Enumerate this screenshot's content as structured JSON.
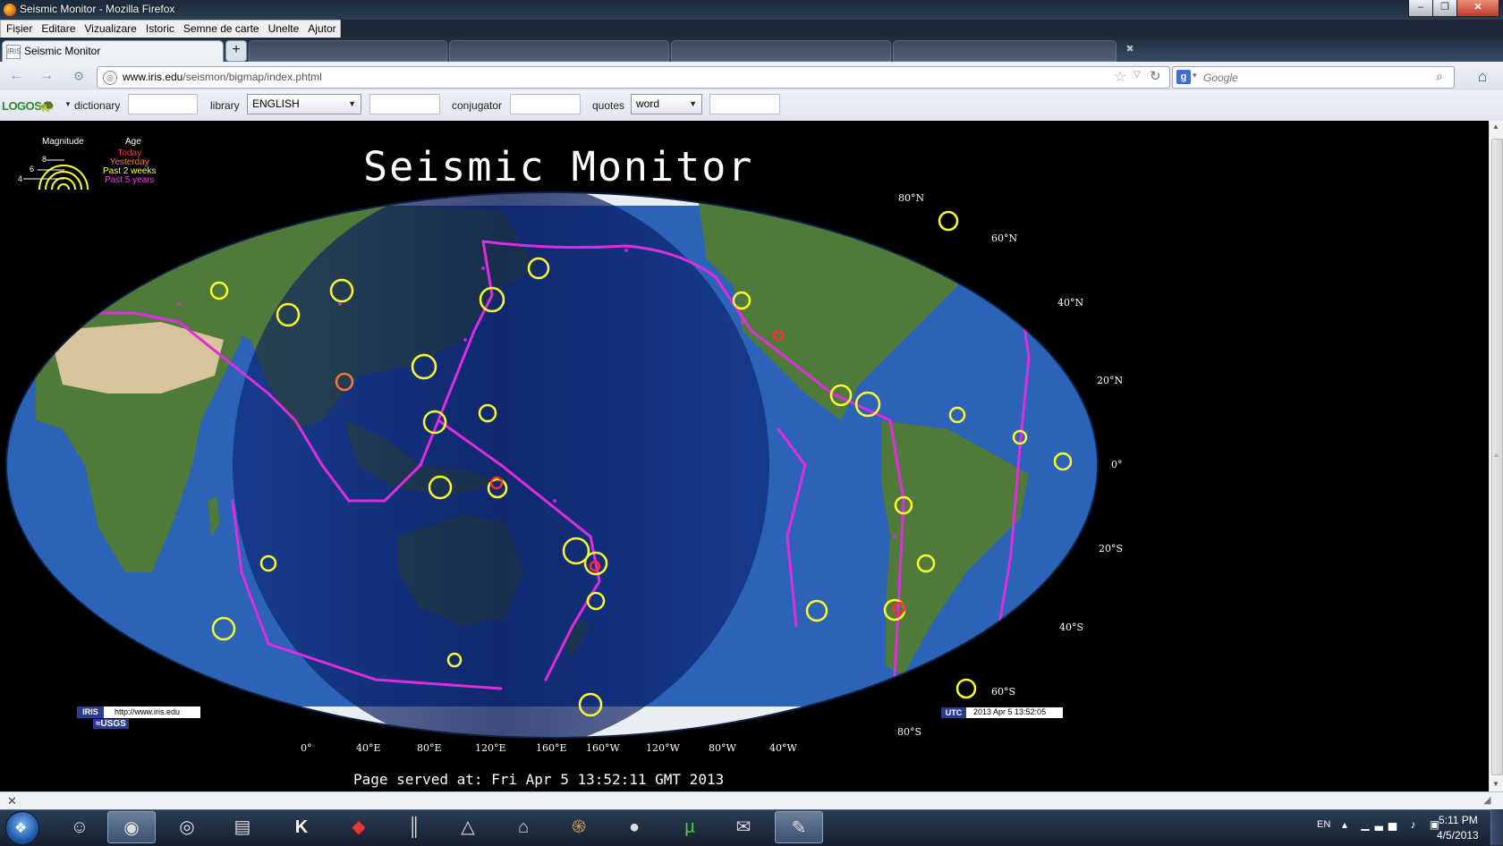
{
  "window": {
    "title": "Seismic Monitor - Mozilla Firefox",
    "minimize": "–",
    "maximize": "❐",
    "close": "✕"
  },
  "menu": [
    "Fișier",
    "Editare",
    "Vizualizare",
    "Istoric",
    "Semne de carte",
    "Unelte",
    "Ajutor"
  ],
  "tabs": {
    "active": "Seismic Monitor",
    "new_tab": "+",
    "scroll": "✖"
  },
  "nav": {
    "url_host": "www.iris.edu",
    "url_path": "/seismon/bigmap/index.phtml",
    "search_placeholder": "Google"
  },
  "addon": {
    "logo": "LOGOS",
    "dictionary_label": "dictionary",
    "library_label": "library",
    "library_value": "ENGLISH",
    "conjugator_label": "conjugator",
    "quotes_label": "quotes",
    "quotes_value": "word"
  },
  "map": {
    "title": "Seismic Monitor",
    "served_at": "Page served at: Fri Apr 5 13:52:11 GMT 2013",
    "legend": {
      "magnitude_label": "Magnitude",
      "age_label": "Age",
      "magnitudes": [
        "8",
        "6",
        "4"
      ],
      "ages": [
        {
          "label": "Today",
          "color": "#ff3030"
        },
        {
          "label": "Yesterday",
          "color": "#ff7a30"
        },
        {
          "label": "Past 2 weeks",
          "color": "#ffff30"
        },
        {
          "label": "Past 5 years",
          "color": "#ff33ff"
        }
      ]
    },
    "lat_labels": [
      "80°N",
      "60°N",
      "40°N",
      "20°N",
      "0°",
      "20°S",
      "40°S",
      "60°S",
      "80°S"
    ],
    "lon_labels": [
      "0°",
      "40°E",
      "80°E",
      "120°E",
      "160°E",
      "160°W",
      "120°W",
      "80°W",
      "40°W"
    ],
    "iris_logo": "IRIS",
    "iris_url": "http://www.iris.edu",
    "usgs_logo": "≈USGS",
    "utc_label": "UTC",
    "utc_value": "2013 Apr 5 13:52:05",
    "colors": {
      "ocean": "#2a63b8",
      "night": "#0b1f6e",
      "land": "#4f7a3a",
      "desert": "#d8c49a",
      "ice": "#e9eef2",
      "plate_boundary": "#e02ce0",
      "quake_recent": "#ffff30"
    }
  },
  "taskbar": {
    "items": [
      "messenger-icon",
      "firefox-icon",
      "chrome-icon",
      "acrobat-icon",
      "k-icon",
      "book-icon",
      "library-icon",
      "inkscape-icon",
      "bank-icon",
      "swirl-icon",
      "dvd-icon",
      "utorrent-icon",
      "mail-icon",
      "paint-icon"
    ],
    "lang": "EN",
    "time": "5:11 PM",
    "date": "4/5/2013"
  }
}
